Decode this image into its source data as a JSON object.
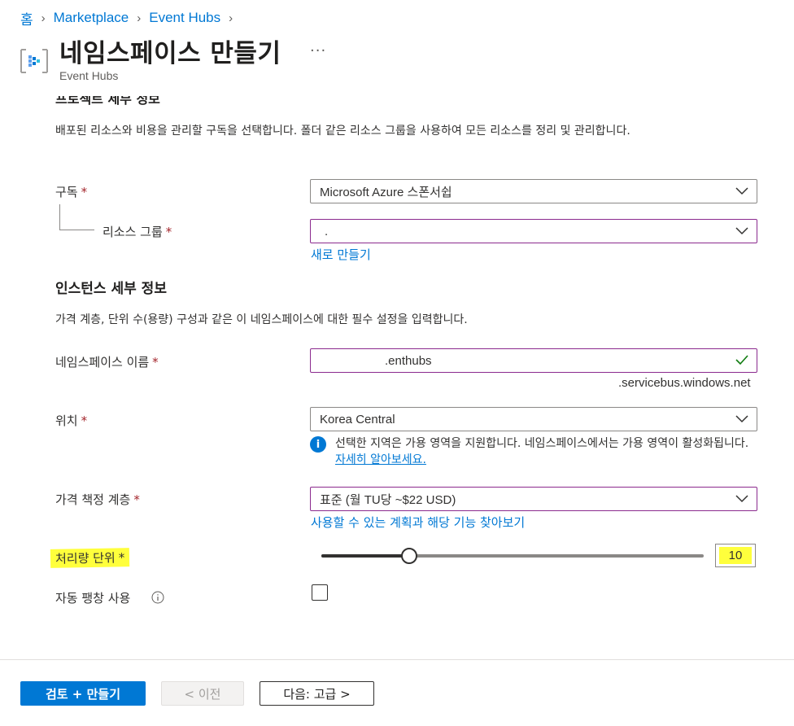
{
  "breadcrumb": {
    "home": "홈",
    "items": [
      "Marketplace",
      "Event Hubs"
    ]
  },
  "header": {
    "title": "네임스페이스 만들기",
    "ellipsis": "···",
    "subtitle": "Event Hubs"
  },
  "project": {
    "section_title": "프로젝트 세부 정보",
    "description": "배포된 리소스와 비용을 관리할 구독을 선택합니다. 폴더 같은 리소스 그룹을 사용하여 모든 리소스를 정리 및 관리합니다.",
    "subscription_label": "구독",
    "subscription_value": "Microsoft Azure 스폰서쉽",
    "resource_group_label": "리소스 그룹",
    "resource_group_value": ".",
    "create_new_link": "새로 만들기"
  },
  "instance": {
    "section_title": "인스턴스 세부 정보",
    "description": "가격 계층, 단위 수(용량) 구성과 같은 이 네임스페이스에 대한 필수 설정을 입력합니다.",
    "namespace_label": "네임스페이스 이름",
    "namespace_value": ".enthubs",
    "namespace_suffix": ".servicebus.windows.net",
    "location_label": "위치",
    "location_value": "Korea Central",
    "location_info": "선택한 지역은 가용 영역을 지원합니다. 네임스페이스에서는 가용 영역이 활성화됩니다.",
    "learn_more": "자세히 알아보세요.",
    "pricing_label": "가격 책정 계층",
    "pricing_value": "표준 (월 TU당 ~$22 USD)",
    "pricing_link": "사용할 수 있는 계획과 해당 기능 찾아보기",
    "throughput_label": "처리량 단위",
    "throughput_value": "10",
    "throughput_fraction": 0.23,
    "autoinflate_label": "자동 팽창 사용",
    "autoinflate_checked": false
  },
  "required_mark": "*",
  "footer": {
    "review_create": "검토 + 만들기",
    "previous": "< 이전",
    "next": "다음: 고급 >"
  },
  "colors": {
    "accent": "#0078d4",
    "required": "#a4262c",
    "highlight": "#ffff3c",
    "valid": "#107c10"
  }
}
